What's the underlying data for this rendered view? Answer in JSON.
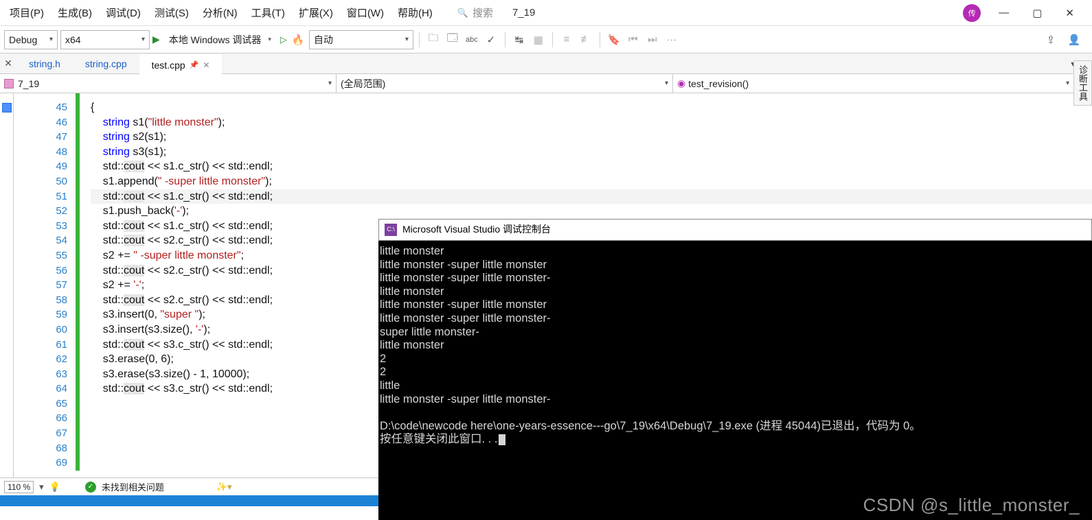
{
  "menu": {
    "items": [
      "项目(P)",
      "生成(B)",
      "调试(D)",
      "测试(S)",
      "分析(N)",
      "工具(T)",
      "扩展(X)",
      "窗口(W)",
      "帮助(H)"
    ],
    "search_placeholder": "搜索",
    "project_name": "7_19",
    "avatar_text": "传"
  },
  "toolbar": {
    "config": "Debug",
    "platform": "x64",
    "debugger_label": "本地 Windows 调试器",
    "auto_label": "自动"
  },
  "tabs": {
    "items": [
      {
        "label": "string.h",
        "active": false
      },
      {
        "label": "string.cpp",
        "active": false
      },
      {
        "label": "test.cpp",
        "active": true
      }
    ]
  },
  "nav": {
    "project": "7_19",
    "scope": "(全局范围)",
    "function": "test_revision()"
  },
  "right_tab": "诊断工具",
  "editor": {
    "lines": [
      {
        "n": 45,
        "g": true,
        "html": "{"
      },
      {
        "n": 46,
        "g": true,
        "html": "    <span class='kw'>string</span> s1(<span class='str'>\"little monster\"</span>);"
      },
      {
        "n": 47,
        "g": true,
        "html": "    <span class='kw'>string</span> s2(s1);"
      },
      {
        "n": 48,
        "g": true,
        "html": "    <span class='kw'>string</span> s3(s1);"
      },
      {
        "n": 49,
        "g": true,
        "html": "    std::<span class='hl'>cout</span> &lt;&lt; s1.c_str() &lt;&lt; std::endl;"
      },
      {
        "n": 50,
        "g": true,
        "html": ""
      },
      {
        "n": 51,
        "g": true,
        "html": "    s1.append(<span class='str'>\" -super little monster\"</span>);"
      },
      {
        "n": 52,
        "g": true,
        "cl": true,
        "html": "    std::<span class='hl'>cout</span> &lt;&lt; s1.c_str() &lt;&lt; std::endl;"
      },
      {
        "n": 53,
        "g": true,
        "html": ""
      },
      {
        "n": 54,
        "g": true,
        "html": "    s1.push_back(<span class='chr'>'-'</span>);"
      },
      {
        "n": 55,
        "g": true,
        "html": "    std::<span class='hl'>cout</span> &lt;&lt; s1.c_str() &lt;&lt; std::endl;"
      },
      {
        "n": 56,
        "g": true,
        "html": ""
      },
      {
        "n": 57,
        "g": true,
        "html": "    std::<span class='hl'>cout</span> &lt;&lt; s2.c_str() &lt;&lt; std::endl;"
      },
      {
        "n": 58,
        "g": true,
        "html": "    s2 += <span class='str'>\" -super little monster\"</span>;"
      },
      {
        "n": 59,
        "g": true,
        "html": "    std::<span class='hl'>cout</span> &lt;&lt; s2.c_str() &lt;&lt; std::endl;"
      },
      {
        "n": 60,
        "g": true,
        "html": "    s2 += <span class='chr'>'-'</span>;"
      },
      {
        "n": 61,
        "g": true,
        "html": "    std::<span class='hl'>cout</span> &lt;&lt; s2.c_str() &lt;&lt; std::endl;"
      },
      {
        "n": 62,
        "g": true,
        "html": ""
      },
      {
        "n": 63,
        "g": true,
        "html": "    s3.insert(0, <span class='str'>\"super \"</span>);"
      },
      {
        "n": 64,
        "g": true,
        "html": "    s3.insert(s3.size(), <span class='chr'>'-'</span>);"
      },
      {
        "n": 65,
        "g": true,
        "html": "    std::<span class='hl'>cout</span> &lt;&lt; s3.c_str() &lt;&lt; std::endl;"
      },
      {
        "n": 66,
        "g": true,
        "html": ""
      },
      {
        "n": 67,
        "g": true,
        "html": "    s3.erase(0, 6);"
      },
      {
        "n": 68,
        "g": true,
        "html": "    s3.erase(s3.size() - 1, 10000);"
      },
      {
        "n": 69,
        "g": true,
        "html": "    std::<span class='hl'>cout</span> &lt;&lt; s3.c_str() &lt;&lt; std::endl;"
      }
    ],
    "top_fragment": "{"
  },
  "status": {
    "zoom": "110 %",
    "issues": "未找到相关问题"
  },
  "console": {
    "title": "Microsoft Visual Studio 调试控制台",
    "lines": [
      "little monster",
      "little monster -super little monster",
      "little monster -super little monster-",
      "little monster",
      "little monster -super little monster",
      "little monster -super little monster-",
      "super little monster-",
      "little monster",
      "2",
      "2",
      "little",
      "little monster -super little monster-",
      "",
      "D:\\code\\newcode here\\one-years-essence---go\\7_19\\x64\\Debug\\7_19.exe (进程 45044)已退出，代码为 0。",
      "按任意键关闭此窗口. . ."
    ]
  },
  "watermark": "CSDN @s_little_monster_"
}
